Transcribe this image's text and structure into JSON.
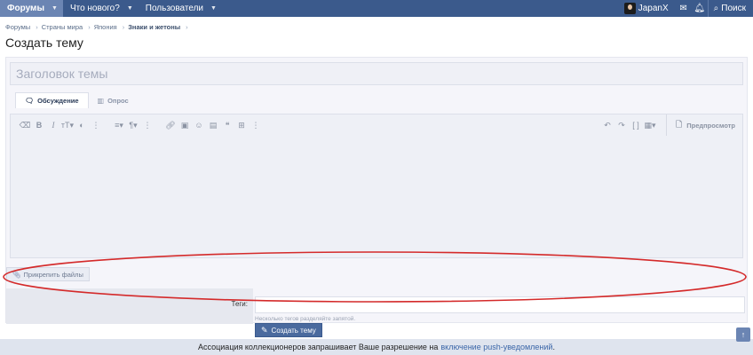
{
  "nav": {
    "tabs": [
      {
        "label": "Форумы",
        "active": true
      },
      {
        "label": "Что нового?",
        "active": false
      },
      {
        "label": "Пользователи",
        "active": false
      }
    ],
    "username": "JapanX",
    "search_label": "Поиск"
  },
  "breadcrumb": [
    "Форумы",
    "Страны мира",
    "Япония",
    "Знаки и жетоны"
  ],
  "page_title": "Создать тему",
  "form": {
    "title_placeholder": "Заголовок темы",
    "tabs": [
      {
        "label": "Обсуждение",
        "icon": "chat-icon"
      },
      {
        "label": "Опрос",
        "icon": "poll-icon"
      }
    ],
    "preview_label": "Предпросмотр",
    "attach_label": "Прикрепить файлы",
    "tags_label": "Теги:",
    "tags_hint": "Несколько тегов разделяйте запятой.",
    "submit_label": "Создать тему"
  },
  "notice": {
    "text": "Ассоциация коллекционеров запрашивает Ваше разрешение на",
    "link": "включение push-уведомлений",
    "end": "."
  },
  "colors": {
    "nav_bg": "#3b5a8c",
    "nav_active": "#6b85b3",
    "annotation": "#d42a2a"
  }
}
